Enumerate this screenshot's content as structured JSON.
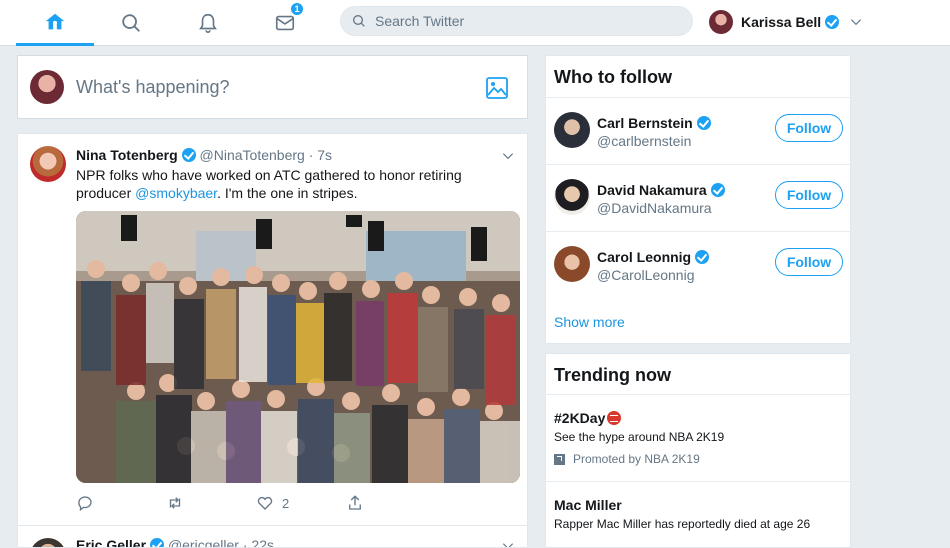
{
  "nav": {
    "notifications_badge": "1",
    "search_placeholder": "Search Twitter",
    "account_name": "Karissa Bell"
  },
  "compose": {
    "placeholder": "What's happening?"
  },
  "tweet": {
    "author": "Nina Totenberg",
    "handle": "@NinaTotenberg",
    "separator": "·",
    "time": "7s",
    "text_part1": "NPR folks who have worked on ATC gathered to honor retiring producer",
    "mention": "@smokybaer",
    "text_part2": ".  I'm the one in stripes.",
    "like_count": "2"
  },
  "next_tweet": {
    "author": "Eric Geller",
    "handle": "@ericgeller",
    "time": "22s"
  },
  "who_to_follow": {
    "title": "Who to follow",
    "follow_label": "Follow",
    "show_more": "Show more",
    "accounts": [
      {
        "name": "Carl Bernstein",
        "handle": "@carlbernstein"
      },
      {
        "name": "David Nakamura",
        "handle": "@DavidNakamura"
      },
      {
        "name": "Carol Leonnig",
        "handle": "@CarolLeonnig"
      }
    ]
  },
  "trending": {
    "title": "Trending now",
    "items": [
      {
        "name": "#2KDay",
        "desc": "See the hype around NBA 2K19",
        "promoted": "Promoted by NBA 2K19"
      },
      {
        "name": "Mac Miller",
        "desc": "Rapper Mac Miller has reportedly died at age 26"
      }
    ]
  },
  "colors": {
    "accent": "#1da1f2",
    "link": "#1b95e0",
    "background": "#e6ecf0",
    "muted_text": "#657786"
  }
}
